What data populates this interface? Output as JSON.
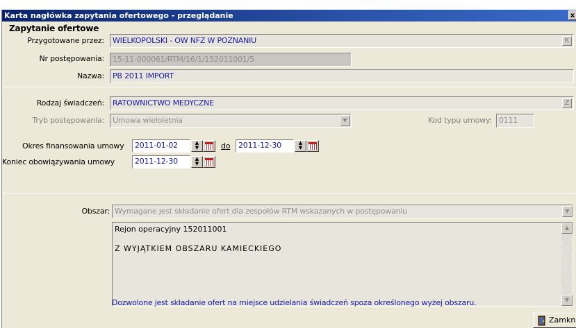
{
  "window": {
    "title": "Karta nagłówka zapytania ofertowego - przeglądanie",
    "close_label": "x"
  },
  "section_title": "Zapytanie ofertowe",
  "prepared_by": {
    "label": "Przygotowane przez:",
    "value": "WIELKOPOLSKI  -  OW NFZ W POZNANIU",
    "button": "K"
  },
  "case_number": {
    "label": "Nr postępowania:",
    "value": "15-11-000061/RTM/16/1/152011001/5"
  },
  "name": {
    "label": "Nazwa:",
    "value": "PB 2011 IMPORT"
  },
  "service_type": {
    "label": "Rodzaj świadczeń:",
    "value": "RATOWNICTWO MEDYCZNE",
    "button": "Z"
  },
  "procedure_mode": {
    "label": "Tryb postępowania:",
    "value": "Umowa wieloletnia"
  },
  "contract_type_code": {
    "label": "Kod typu umowy:",
    "value": "0111"
  },
  "financing_period": {
    "label": "Okres finansowania umowy",
    "from": "2011-01-02",
    "to_label": "do",
    "to": "2011-12-30"
  },
  "validity_end": {
    "label": "Koniec obowiązywania umowy",
    "value": "2011-12-30"
  },
  "area": {
    "label": "Obszar:",
    "value": "Wymagane jest składanie ofert dla zespołów RTM wskazanych w postępowaniu",
    "memo_lines": [
      "Rejon operacyjny 152011001",
      "Z WYJĄTKIEM OBSZARU KAMIECKIEGO"
    ],
    "note": "Dozwolone jest składanie ofert na miejsce udzielania świadczeń spoza określonego wyżej obszaru."
  },
  "close_button": {
    "label": "Zamknij"
  }
}
